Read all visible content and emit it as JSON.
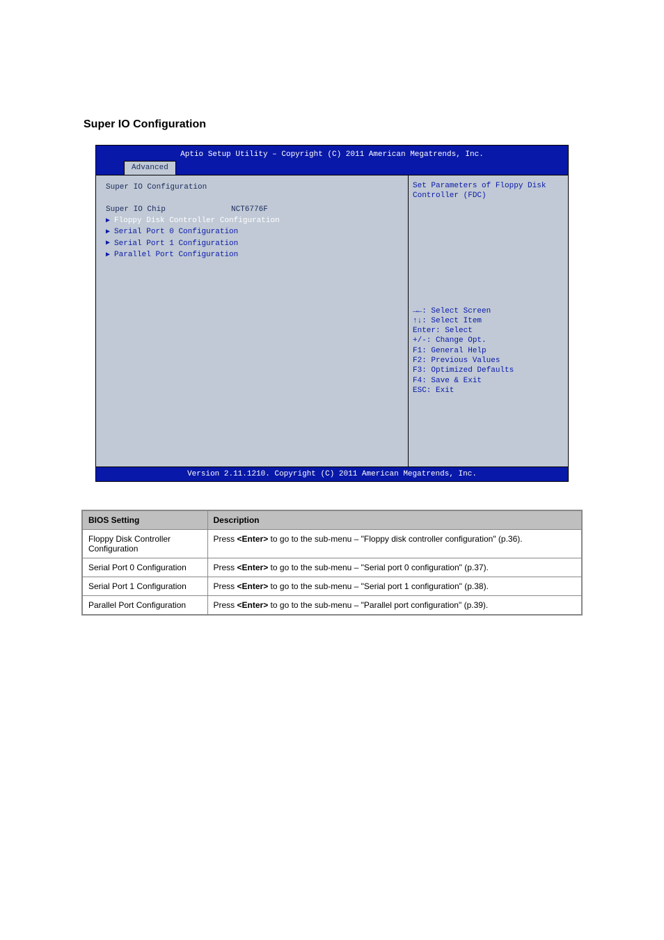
{
  "page": {
    "section_title": "Super IO Configuration"
  },
  "bios": {
    "header": "Aptio Setup Utility – Copyright (C) 2011 American Megatrends, Inc.",
    "tab": "Advanced",
    "footer": "Version 2.11.1210. Copyright (C) 2011 American Megatrends, Inc.",
    "main_title": "Super IO Configuration",
    "chip_label": "Super IO Chip",
    "chip_value": "NCT6776F",
    "submenus": [
      "Floppy Disk Controller Configuration",
      "Serial Port 0 Configuration",
      "Serial Port 1 Configuration",
      "Parallel Port Configuration"
    ],
    "help_text": "Set Parameters of Floppy Disk Controller (FDC)",
    "keys": [
      "→←: Select Screen",
      "↑↓: Select Item",
      "Enter: Select",
      "+/-: Change Opt.",
      "F1: General Help",
      "F2: Previous Values",
      "F3: Optimized Defaults",
      "F4: Save & Exit",
      "ESC: Exit"
    ]
  },
  "table": {
    "headers": [
      "BIOS Setting",
      "Description"
    ],
    "rows": [
      {
        "setting": "Floppy Disk Controller Configuration",
        "desc_prefix": "Press ",
        "desc_key": "<Enter>",
        "desc_mid": " to go to the sub-menu – ",
        "desc_q": "\"Floppy disk controller configuration\"",
        "desc_suffix": " (p.36)."
      },
      {
        "setting": "Serial Port 0 Configuration",
        "desc_prefix": "Press ",
        "desc_key": "<Enter>",
        "desc_mid": " to go to the sub-menu – ",
        "desc_q": "\"Serial port 0 configuration\"",
        "desc_suffix": " (p.37)."
      },
      {
        "setting": "Serial Port 1 Configuration",
        "desc_prefix": "Press ",
        "desc_key": "<Enter>",
        "desc_mid": " to go to the sub-menu – ",
        "desc_q": "\"Serial port 1 configuration\"",
        "desc_suffix": " (p.38)."
      },
      {
        "setting": "Parallel Port Configuration",
        "desc_prefix": "Press ",
        "desc_key": "<Enter>",
        "desc_mid": " to go to the sub-menu – ",
        "desc_q": "\"Parallel port configuration\"",
        "desc_suffix": " (p.39)."
      }
    ]
  }
}
